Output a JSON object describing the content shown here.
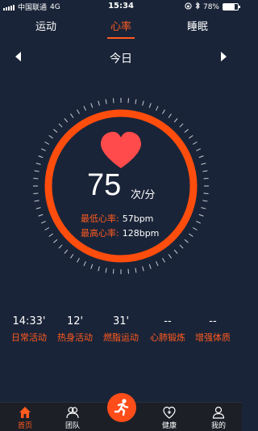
{
  "status_bar": {
    "carrier": "中国联通",
    "network": "4G",
    "time": "15:34",
    "battery": "78%",
    "battery_level": 0.78
  },
  "tabs": [
    {
      "label": "运动",
      "active": false
    },
    {
      "label": "心率",
      "active": true
    },
    {
      "label": "睡眠",
      "active": false
    }
  ],
  "date_nav": {
    "label": "今日",
    "prev_icon": "triangle-left-icon",
    "next_icon": "triangle-right-icon"
  },
  "heart_rate": {
    "icon": "heart-icon",
    "value": "75",
    "unit": "次/分",
    "min_label": "最低心率:",
    "min_value": "57bpm",
    "max_label": "最高心率:",
    "max_value": "128bpm"
  },
  "activities": [
    {
      "value": "14:33'",
      "label": "日常活动"
    },
    {
      "value": "12'",
      "label": "热身活动"
    },
    {
      "value": "31'",
      "label": "燃脂运动"
    },
    {
      "value": "--",
      "label": "心肺锻炼"
    },
    {
      "value": "--",
      "label": "增强体质"
    }
  ],
  "bottom_nav": [
    {
      "label": "首页",
      "icon": "home-icon",
      "active": true
    },
    {
      "label": "团队",
      "icon": "team-icon",
      "active": false
    },
    {
      "label": "",
      "icon": "runner-icon",
      "active": false
    },
    {
      "label": "健康",
      "icon": "health-heart-plus-icon",
      "active": false
    },
    {
      "label": "我的",
      "icon": "profile-icon",
      "active": false
    }
  ],
  "colors": {
    "accent": "#ff5a1f",
    "background": "#1a2438",
    "heart": "#ff4b4b"
  }
}
